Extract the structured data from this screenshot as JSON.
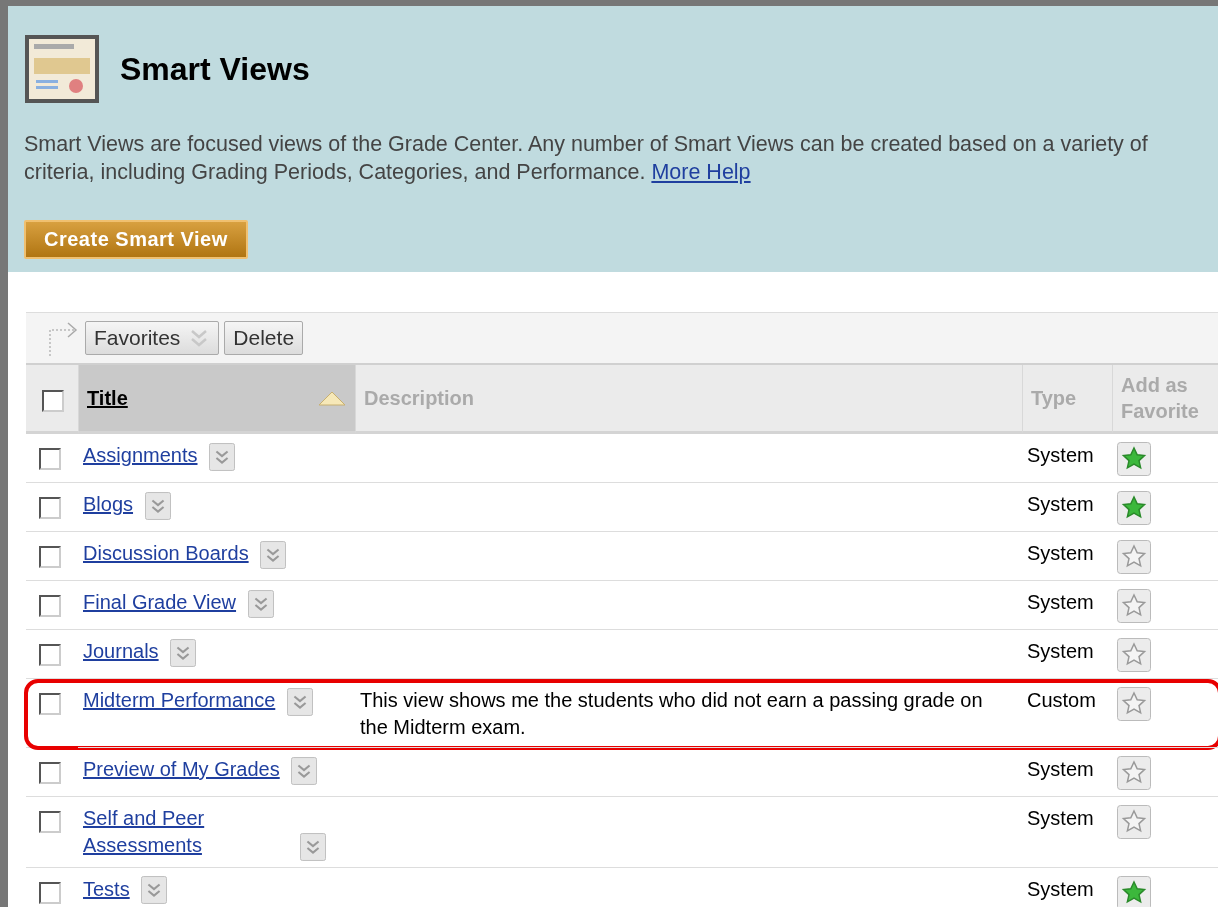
{
  "header": {
    "title": "Smart Views",
    "description": "Smart Views are focused views of the Grade Center. Any number of Smart Views can be created based on a variety of criteria, including Grading Periods, Categories, and Performance.",
    "help_link": "More Help",
    "create_button": "Create Smart View"
  },
  "toolbar": {
    "buttons": [
      {
        "label": "Favorites",
        "kind": "menu"
      },
      {
        "label": "Delete",
        "kind": "plain"
      }
    ]
  },
  "table": {
    "columns": [
      {
        "label": "Title",
        "sorted": true
      },
      {
        "label": "Description",
        "sorted": false
      },
      {
        "label": "Type",
        "sorted": false
      },
      {
        "label": "Add as Favorite",
        "sorted": false
      }
    ],
    "select_all_checked": false,
    "rows": [
      {
        "title": "Assignments",
        "description": "",
        "type": "System",
        "favorite": true,
        "checked": false,
        "highlighted": false
      },
      {
        "title": "Blogs",
        "type": "System",
        "favorite": true,
        "checked": false,
        "highlighted": false
      },
      {
        "title": "Discussion Boards",
        "type": "System",
        "favorite": false,
        "checked": false,
        "highlighted": false
      },
      {
        "title": "Final Grade View",
        "type": "System",
        "favorite": false,
        "checked": false,
        "highlighted": false
      },
      {
        "title": "Journals",
        "type": "System",
        "favorite": false,
        "checked": false,
        "highlighted": false
      },
      {
        "title": "Midterm Performance",
        "description": "This view shows me the students who did not earn a passing grade on the Midterm exam.",
        "type": "Custom",
        "favorite": false,
        "checked": false,
        "highlighted": true
      },
      {
        "title": "Preview of My Grades",
        "type": "System",
        "favorite": false,
        "checked": false,
        "highlighted": false
      },
      {
        "title": "Self and Peer Assessments",
        "type": "System",
        "favorite": false,
        "checked": false,
        "highlighted": false
      },
      {
        "title": "Tests",
        "type": "System",
        "favorite": true,
        "checked": false,
        "highlighted": false
      }
    ]
  }
}
